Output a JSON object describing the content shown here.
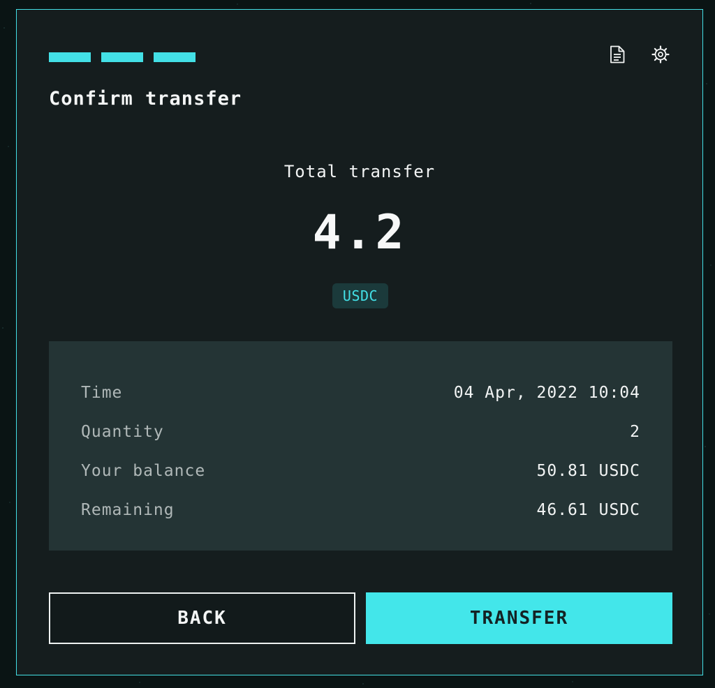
{
  "header": {
    "steps_total": 3,
    "title": "Confirm transfer",
    "icons": [
      "document-icon",
      "gear-icon"
    ]
  },
  "summary": {
    "label": "Total transfer",
    "amount": "4.2",
    "currency": "USDC"
  },
  "details": {
    "rows": [
      {
        "label": "Time",
        "value": "04 Apr, 2022 10:04"
      },
      {
        "label": "Quantity",
        "value": "2"
      },
      {
        "label": "Your balance",
        "value": "50.81 USDC"
      },
      {
        "label": "Remaining",
        "value": "46.61 USDC"
      }
    ]
  },
  "actions": {
    "back_label": "BACK",
    "transfer_label": "TRANSFER"
  },
  "colors": {
    "accent": "#43e0e6",
    "panel_bg": "#151d1e",
    "details_bg": "#243435"
  }
}
